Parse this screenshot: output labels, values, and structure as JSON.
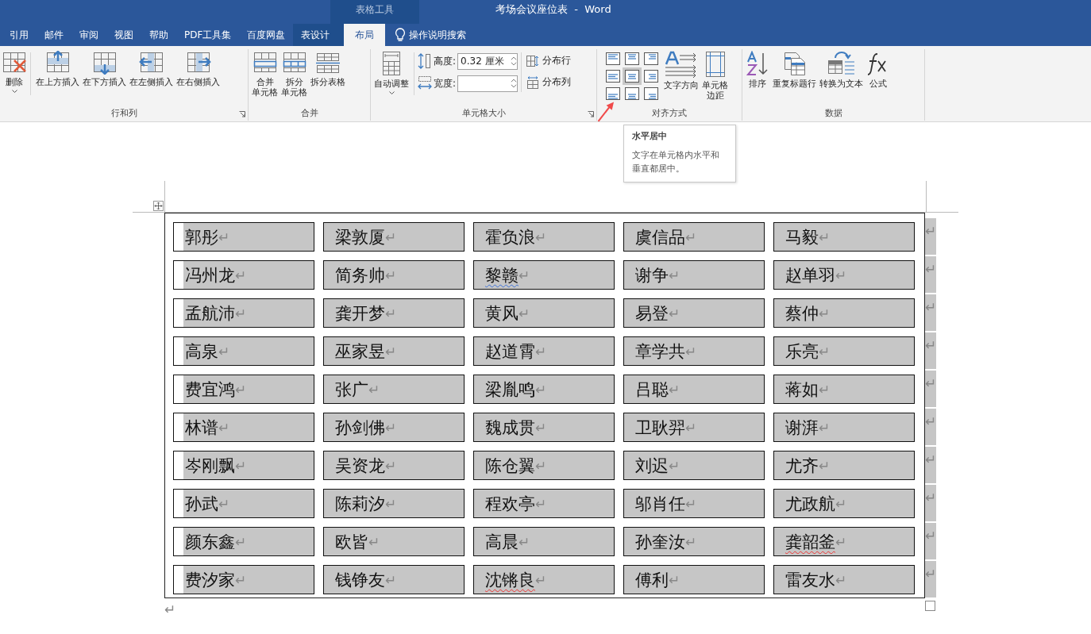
{
  "window": {
    "title": "考场会议座位表  -  Word",
    "context_group": "表格工具"
  },
  "tabs": [
    {
      "label": "引用",
      "selected": false,
      "kind": "normal"
    },
    {
      "label": "邮件",
      "selected": false,
      "kind": "normal"
    },
    {
      "label": "审阅",
      "selected": false,
      "kind": "normal"
    },
    {
      "label": "视图",
      "selected": false,
      "kind": "normal"
    },
    {
      "label": "帮助",
      "selected": false,
      "kind": "normal"
    },
    {
      "label": "PDF工具集",
      "selected": false,
      "kind": "normal"
    },
    {
      "label": "百度网盘",
      "selected": false,
      "kind": "normal"
    },
    {
      "label": "表设计",
      "selected": false,
      "kind": "context"
    },
    {
      "label": "布局",
      "selected": true,
      "kind": "context"
    }
  ],
  "tell_me": {
    "placeholder": "操作说明搜索"
  },
  "ribbon": {
    "rows_columns": {
      "label": "行和列",
      "buttons": [
        {
          "label": "删除",
          "dropdown": true
        },
        {
          "label": "在上方插入",
          "dropdown": false
        },
        {
          "label": "在下方插入",
          "dropdown": false
        },
        {
          "label": "在左侧插入",
          "dropdown": false
        },
        {
          "label": "在右侧插入",
          "dropdown": false
        }
      ]
    },
    "merge": {
      "label": "合并",
      "buttons": [
        {
          "lines": [
            "合并",
            "单元格"
          ]
        },
        {
          "lines": [
            "拆分",
            "单元格"
          ]
        },
        {
          "lines": [
            "拆分表格"
          ]
        }
      ]
    },
    "cell_size": {
      "label": "单元格大小",
      "autofit": "自动调整",
      "height_label": "高度:",
      "height_value": "0.32 厘米",
      "width_label": "宽度:",
      "distribute_rows": "分布行",
      "distribute_columns": "分布列"
    },
    "alignment": {
      "label": "对齐方式",
      "buttons": [
        {
          "selected": false
        },
        {
          "selected": false
        },
        {
          "selected": false
        },
        {
          "selected": false
        },
        {
          "selected": true
        },
        {
          "selected": false
        },
        {
          "selected": false
        },
        {
          "selected": false
        },
        {
          "selected": false
        }
      ],
      "text_direction": "文字方向",
      "cell_margins": [
        "单元格",
        "边距"
      ]
    },
    "data": {
      "label": "数据",
      "buttons": [
        {
          "label": "排序"
        },
        {
          "label": "重复标题行"
        },
        {
          "label": "转换为文本"
        },
        {
          "label": "公式"
        }
      ]
    }
  },
  "tooltip": {
    "title": "水平居中",
    "body": [
      "文字在单元格内水平和",
      "垂直都居中。"
    ]
  },
  "table": {
    "rows": [
      {
        "end_mark": "↵",
        "cells": [
          {
            "text": "郭彤",
            "mark": "↵",
            "kind": "plain"
          },
          {
            "text": "梁敦厦",
            "mark": "↵",
            "kind": "plain"
          },
          {
            "text": "霍负浪",
            "mark": "↵",
            "kind": "plain"
          },
          {
            "text": "虞信品",
            "mark": "↵",
            "kind": "plain"
          },
          {
            "text": "马毅",
            "mark": "↵",
            "kind": "plain"
          }
        ]
      },
      {
        "end_mark": "↵",
        "cells": [
          {
            "text": "冯州龙",
            "mark": "↵",
            "kind": "plain"
          },
          {
            "text": "简务帅",
            "mark": "↵",
            "kind": "plain"
          },
          {
            "text": "黎赣",
            "mark": "↵",
            "kind": "grammar"
          },
          {
            "text": "谢争",
            "mark": "↵",
            "kind": "plain"
          },
          {
            "text": "赵单羽",
            "mark": "↵",
            "kind": "plain"
          }
        ]
      },
      {
        "end_mark": "↵",
        "cells": [
          {
            "text": "孟航沛",
            "mark": "↵",
            "kind": "plain"
          },
          {
            "text": "龚开梦",
            "mark": "↵",
            "kind": "plain"
          },
          {
            "text": "黄风",
            "mark": "↵",
            "kind": "plain"
          },
          {
            "text": "易登",
            "mark": "↵",
            "kind": "plain"
          },
          {
            "text": "蔡仲",
            "mark": "↵",
            "kind": "plain"
          }
        ]
      },
      {
        "end_mark": "↵",
        "cells": [
          {
            "text": "高泉",
            "mark": "↵",
            "kind": "plain"
          },
          {
            "text": "巫家昱",
            "mark": "↵",
            "kind": "plain"
          },
          {
            "text": "赵道霄",
            "mark": "↵",
            "kind": "plain"
          },
          {
            "text": "章学共",
            "mark": "↵",
            "kind": "plain"
          },
          {
            "text": "乐亮",
            "mark": "↵",
            "kind": "plain"
          }
        ]
      },
      {
        "end_mark": "↵",
        "cells": [
          {
            "text": "费宜鸿",
            "mark": "↵",
            "kind": "plain"
          },
          {
            "text": "张广",
            "mark": "↵",
            "kind": "plain"
          },
          {
            "text": "梁胤鸣",
            "mark": "↵",
            "kind": "plain"
          },
          {
            "text": "吕聪",
            "mark": "↵",
            "kind": "plain"
          },
          {
            "text": "蒋如",
            "mark": "↵",
            "kind": "plain"
          }
        ]
      },
      {
        "end_mark": "↵",
        "cells": [
          {
            "text": "林谱",
            "mark": "↵",
            "kind": "plain"
          },
          {
            "text": "孙剑佛",
            "mark": "↵",
            "kind": "plain"
          },
          {
            "text": "魏成贯",
            "mark": "↵",
            "kind": "plain"
          },
          {
            "text": "卫耿羿",
            "mark": "↵",
            "kind": "plain"
          },
          {
            "text": "谢湃",
            "mark": "↵",
            "kind": "plain"
          }
        ]
      },
      {
        "end_mark": "↵",
        "cells": [
          {
            "text": "岑刚飘",
            "mark": "↵",
            "kind": "plain"
          },
          {
            "text": "吴资龙",
            "mark": "↵",
            "kind": "plain"
          },
          {
            "text": "陈仓翼",
            "mark": "↵",
            "kind": "plain"
          },
          {
            "text": "刘迟",
            "mark": "↵",
            "kind": "plain"
          },
          {
            "text": "尤齐",
            "mark": "↵",
            "kind": "plain"
          }
        ]
      },
      {
        "end_mark": "↵",
        "cells": [
          {
            "text": "孙武",
            "mark": "↵",
            "kind": "plain"
          },
          {
            "text": "陈莉汐",
            "mark": "↵",
            "kind": "plain"
          },
          {
            "text": "程欢亭",
            "mark": "↵",
            "kind": "plain"
          },
          {
            "text": "邬肖任",
            "mark": "↵",
            "kind": "plain"
          },
          {
            "text": "尤政航",
            "mark": "↵",
            "kind": "plain"
          }
        ]
      },
      {
        "end_mark": "↵",
        "cells": [
          {
            "text": "颜东鑫",
            "mark": "↵",
            "kind": "plain"
          },
          {
            "text": "欧皆",
            "mark": "↵",
            "kind": "plain"
          },
          {
            "text": "高晨",
            "mark": "↵",
            "kind": "plain"
          },
          {
            "text": "孙奎汝",
            "mark": "↵",
            "kind": "plain"
          },
          {
            "text": "龚韶釜",
            "mark": "↵",
            "kind": "spelling"
          }
        ]
      },
      {
        "end_mark": "↵",
        "cells": [
          {
            "text": "费汐家",
            "mark": "↵",
            "kind": "plain"
          },
          {
            "text": "钱铮友",
            "mark": "↵",
            "kind": "plain"
          },
          {
            "text": "沈锵良",
            "mark": "↵",
            "kind": "spelling"
          },
          {
            "text": "傅利",
            "mark": "↵",
            "kind": "plain"
          },
          {
            "text": "雷友水",
            "mark": "↵",
            "kind": "plain"
          }
        ]
      }
    ]
  },
  "after_table_mark": "↵"
}
